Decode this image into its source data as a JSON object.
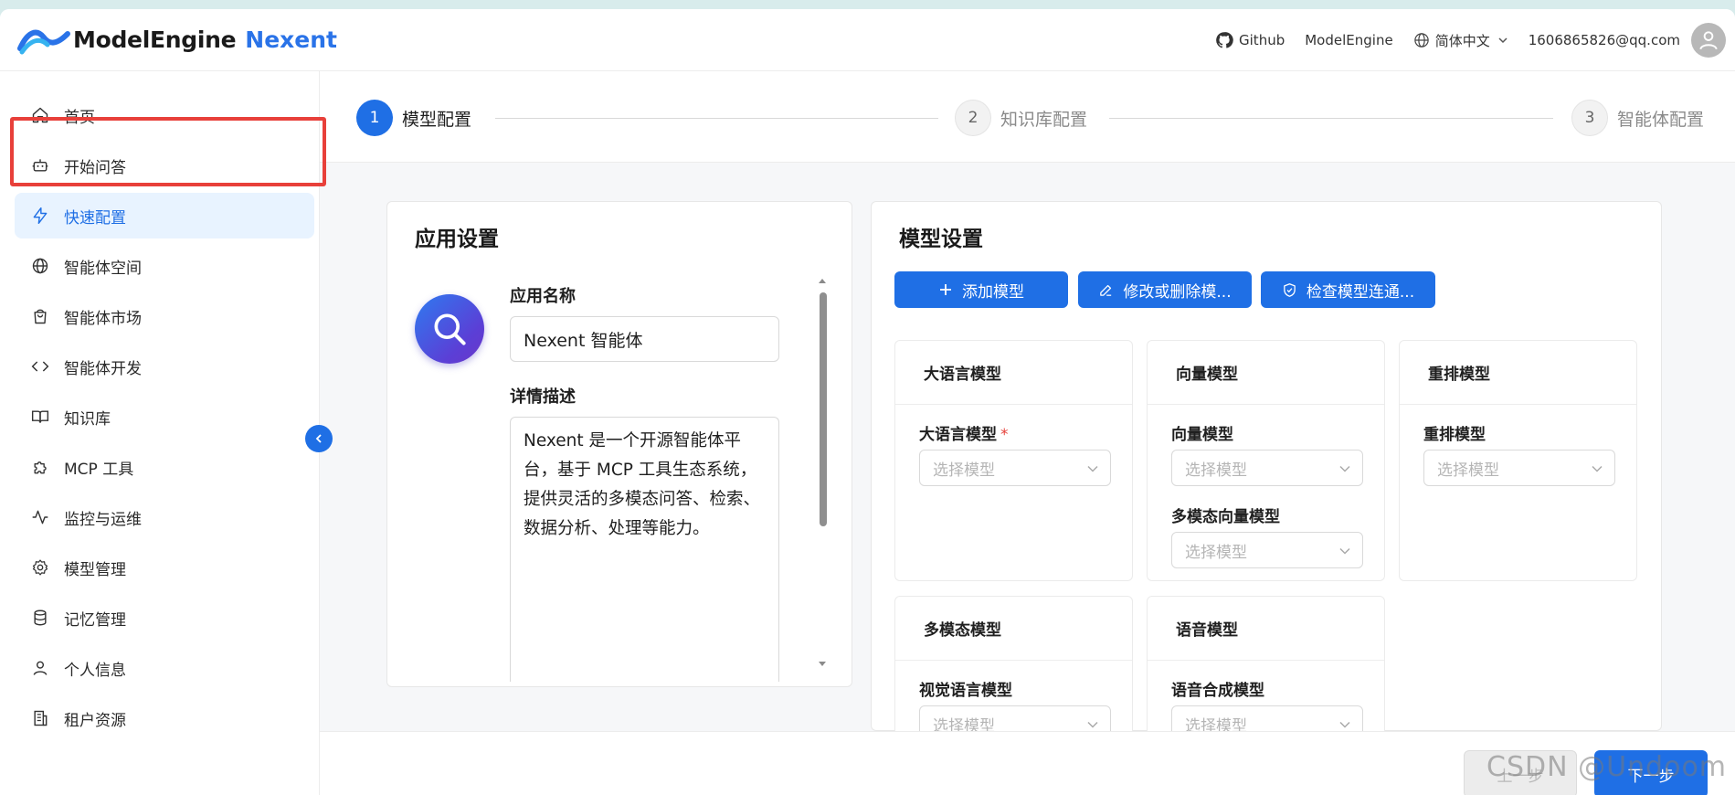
{
  "header": {
    "logo_text": "ModelEngine",
    "logo_accent": "Nexent",
    "links": {
      "github": "Github",
      "modelengine": "ModelEngine",
      "language": "简体中文",
      "user_email": "1606865826@qq.com"
    }
  },
  "sidebar": {
    "items": [
      {
        "label": "首页",
        "icon": "home-icon"
      },
      {
        "label": "开始问答",
        "icon": "robot-icon"
      },
      {
        "label": "快速配置",
        "icon": "bolt-icon",
        "active": true
      },
      {
        "label": "智能体空间",
        "icon": "globe-icon"
      },
      {
        "label": "智能体市场",
        "icon": "shopping-bag-icon"
      },
      {
        "label": "智能体开发",
        "icon": "code-icon"
      },
      {
        "label": "知识库",
        "icon": "book-icon"
      },
      {
        "label": "MCP 工具",
        "icon": "puzzle-icon"
      },
      {
        "label": "监控与运维",
        "icon": "activity-icon"
      },
      {
        "label": "模型管理",
        "icon": "gear-icon"
      },
      {
        "label": "记忆管理",
        "icon": "database-icon"
      },
      {
        "label": "个人信息",
        "icon": "user-icon"
      },
      {
        "label": "租户资源",
        "icon": "building-icon"
      }
    ]
  },
  "steps": [
    {
      "number": "1",
      "label": "模型配置",
      "active": true
    },
    {
      "number": "2",
      "label": "知识库配置",
      "active": false
    },
    {
      "number": "3",
      "label": "智能体配置",
      "active": false
    }
  ],
  "app_settings": {
    "title": "应用设置",
    "name_label": "应用名称",
    "name_value": "Nexent 智能体",
    "desc_label": "详情描述",
    "desc_value": "Nexent 是一个开源智能体平台，基于 MCP 工具生态系统，提供灵活的多模态问答、检索、数据分析、处理等能力。"
  },
  "model_settings": {
    "title": "模型设置",
    "buttons": {
      "add": "添加模型",
      "edit": "修改或删除模...",
      "check": "检查模型连通..."
    },
    "placeholder": "选择模型",
    "cards": {
      "llm": {
        "title": "大语言模型",
        "field": "大语言模型",
        "required_mark": "*"
      },
      "embedding": {
        "title": "向量模型",
        "field": "向量模型",
        "field2": "多模态向量模型"
      },
      "rerank": {
        "title": "重排模型",
        "field": "重排模型"
      },
      "multimodal": {
        "title": "多模态模型",
        "field": "视觉语言模型"
      },
      "voice": {
        "title": "语音模型",
        "field": "语音合成模型"
      }
    }
  },
  "footer": {
    "prev_label": "上一步",
    "next_label": "下一步"
  },
  "watermark": "CSDN @Undoom",
  "colors": {
    "primary": "#1f6fe5",
    "active_bg": "#e8f3ff",
    "highlight": "#e8403a",
    "required": "#e5413a"
  }
}
